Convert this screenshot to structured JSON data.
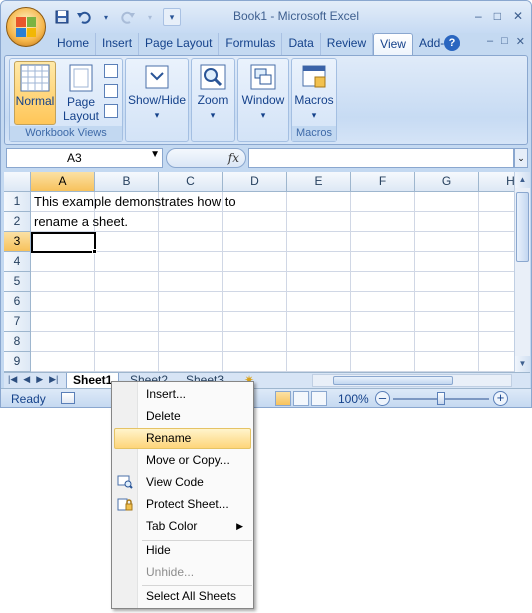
{
  "window": {
    "title": "Book1 - Microsoft Excel"
  },
  "quick_access": {
    "save": "save-icon",
    "undo": "undo-icon",
    "redo": "redo-icon",
    "customize": "▾"
  },
  "window_controls": [
    "–",
    "□",
    "✕"
  ],
  "ribbon_tabs": [
    "Home",
    "Insert",
    "Page Layout",
    "Formulas",
    "Data",
    "Review",
    "View",
    "Add-Ins"
  ],
  "active_tab": "View",
  "ribbon_controls": [
    "–",
    "□",
    "✕"
  ],
  "ribbon": {
    "workbook_views": {
      "label": "Workbook Views",
      "normal": "Normal",
      "page_layout_1": "Page",
      "page_layout_2": "Layout"
    },
    "show_hide": {
      "label": "Show/Hide",
      "arrow": "▾"
    },
    "zoom": {
      "label": "Zoom",
      "arrow": "▾"
    },
    "window": {
      "label": "Window",
      "arrow": "▾"
    },
    "macros": {
      "label": "Macros",
      "arrow": "▾",
      "group_label": "Macros"
    }
  },
  "formula_bar": {
    "name_box": "A3",
    "fx": "fx",
    "formula": ""
  },
  "grid": {
    "columns": [
      "A",
      "B",
      "C",
      "D",
      "E",
      "F",
      "G",
      "H"
    ],
    "rows": [
      "1",
      "2",
      "3",
      "4",
      "5",
      "6",
      "7",
      "8",
      "9"
    ],
    "selected_cell": "A3",
    "cells": {
      "A1": "This example demonstrates how to",
      "A2": "rename a sheet."
    }
  },
  "sheets": [
    "Sheet1",
    "Sheet2",
    "Sheet3"
  ],
  "active_sheet": "Sheet1",
  "status_bar": {
    "status": "Ready",
    "zoom": "100%",
    "minus": "–",
    "plus": "+"
  },
  "context_menu": {
    "items": [
      {
        "label": "Insert...",
        "icon": ""
      },
      {
        "label": "Delete",
        "icon": ""
      },
      {
        "label": "Rename",
        "icon": "",
        "highlighted": true
      },
      {
        "label": "Move or Copy...",
        "icon": ""
      },
      {
        "label": "View Code",
        "icon": "view-code-icon"
      },
      {
        "label": "Protect Sheet...",
        "icon": "protect-sheet-icon"
      },
      {
        "label": "Tab Color",
        "icon": "",
        "submenu": "▶"
      },
      {
        "label": "Hide",
        "icon": ""
      },
      {
        "label": "Unhide...",
        "icon": "",
        "disabled": true
      },
      {
        "label": "Select All Sheets",
        "icon": ""
      }
    ]
  }
}
